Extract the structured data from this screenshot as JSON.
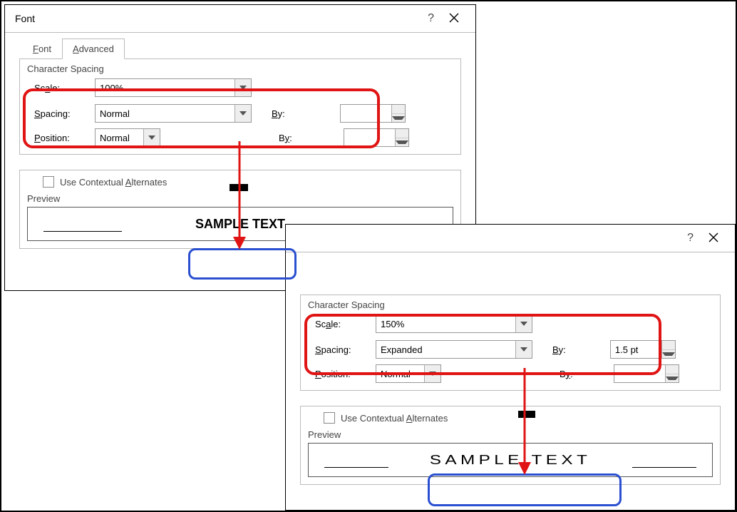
{
  "dialog": {
    "title": "Font",
    "help": "?",
    "tabs": {
      "font": "Font",
      "advanced": "Advanced"
    },
    "section": "Character Spacing",
    "labels": {
      "scale": "Scale:",
      "spacing": "Spacing:",
      "position": "Position:",
      "by": "By:",
      "contextual_pre": "Use Contextual ",
      "contextual_a": "A",
      "contextual_post": "lternates",
      "preview": "Preview"
    }
  },
  "panel1": {
    "scale": "100%",
    "spacing": "Normal",
    "position": "Normal",
    "by_spacing": "",
    "by_position": "",
    "sample": "SAMPLE TEXT"
  },
  "panel2": {
    "scale": "150%",
    "spacing": "Expanded",
    "position": "Normal",
    "by_spacing": "1.5 pt",
    "by_position": "",
    "sample": "SAMPLE TEXT"
  }
}
